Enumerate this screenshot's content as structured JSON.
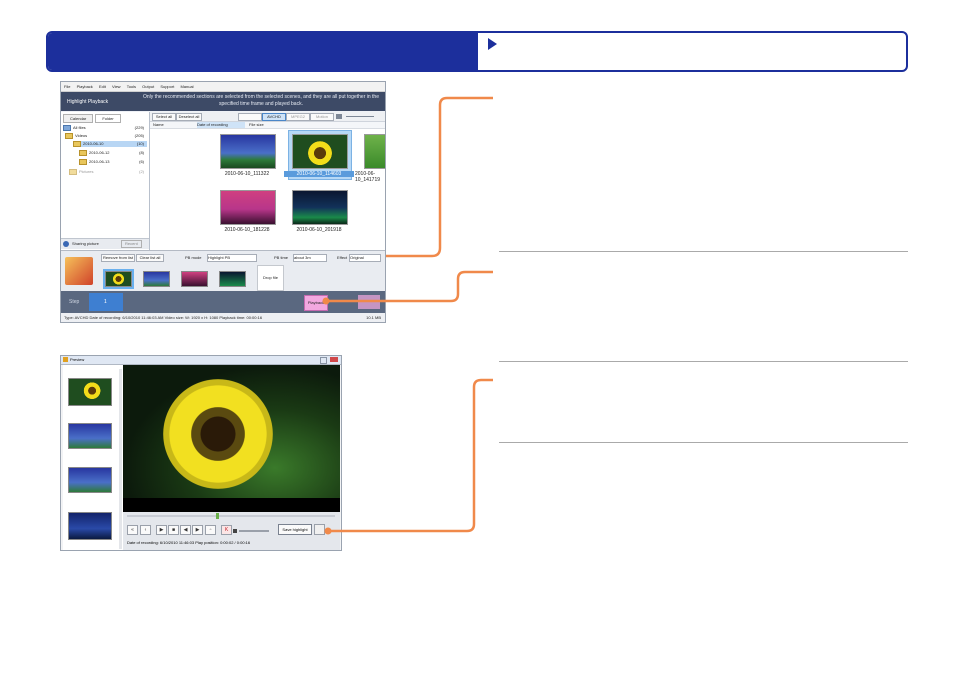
{
  "window1": {
    "menu": [
      "File",
      "Playback",
      "Edit",
      "View",
      "Tools",
      "Output",
      "Support",
      "Manual"
    ],
    "header_title": "Highlight Playback",
    "header_desc": "Only the recommended sections are selected from the selected scenes, and they are all put together in the specified time frame and played back.",
    "tabs": [
      "Calendar",
      "Folder"
    ],
    "tree": [
      {
        "label": "All files",
        "count": "(229)"
      },
      {
        "label": "Videos",
        "count": "(205)"
      },
      {
        "label": "2010-06-10",
        "count": "(10)"
      },
      {
        "label": "2010-06-12",
        "count": "(8)"
      },
      {
        "label": "2010-06-13",
        "count": "(6)"
      },
      {
        "label": "Pictures",
        "count": "(2)"
      }
    ],
    "left_bottom": [
      "Sharing picture",
      "Recent"
    ],
    "toolbar": {
      "select_all": "Select all",
      "deselect_all": "Deselect all",
      "avchd": "AVCHD",
      "mpeg2": "MPEG2",
      "mp4": "Motion"
    },
    "sort": {
      "name": "Name",
      "date": "Date of recording",
      "file_size": "File size"
    },
    "thumbs": [
      {
        "label": "2010-06-10_111322"
      },
      {
        "label": "2010-06-10_114603"
      },
      {
        "label": "2010-06-10_141719"
      },
      {
        "label": "2010-06-10_181228"
      },
      {
        "label": "2010-06-10_201918"
      }
    ],
    "lower": {
      "remove": "Remove from list",
      "clear": "Clear list all",
      "pb_mode": "PB mode",
      "pb_mode_val": "Highlight PB",
      "pb_time": "PB time",
      "pb_time_val": "about 3m",
      "effect": "Effect",
      "effect_val": "Original",
      "drop": "Drop file"
    },
    "steps": {
      "step": "Step",
      "num": "1",
      "playback": "Playback"
    },
    "status": "Type: AVCHD   Date of recording: 6/10/2010 11:46:03 AM   Video size: W: 1920 x H: 1080   Playback time: 00:00:16",
    "status_right": "10.1 MB"
  },
  "window2": {
    "title": "Preview",
    "timecode": "Date of recording: 6/10/2010 11:46:03     Play position: 0:00:02 / 0:00:16",
    "save_btn": "Save highlight"
  },
  "colors": {
    "brand_blue": "#1c2f9c",
    "callout_orange": "#f0894a"
  }
}
